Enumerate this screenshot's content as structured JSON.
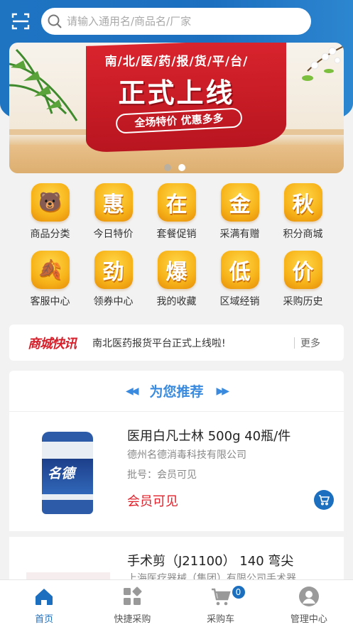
{
  "header": {
    "search_placeholder": "请输入通用名/商品名/厂家",
    "scan_icon": "scan-icon",
    "search_icon": "search-icon"
  },
  "banner": {
    "line1": "南/北/医/药/报/货/平/台/",
    "line2": "正式上线",
    "line3": "全场特价  优惠多多",
    "slide_count": 2,
    "active_slide": 2
  },
  "grid": [
    {
      "label": "商品分类",
      "glyph": "🐻"
    },
    {
      "label": "今日特价",
      "glyph": "惠"
    },
    {
      "label": "套餐促销",
      "glyph": "在"
    },
    {
      "label": "采满有赠",
      "glyph": "金"
    },
    {
      "label": "积分商城",
      "glyph": "秋"
    },
    {
      "label": "客服中心",
      "glyph": "🍂"
    },
    {
      "label": "领券中心",
      "glyph": "劲"
    },
    {
      "label": "我的收藏",
      "glyph": "爆"
    },
    {
      "label": "区域经销",
      "glyph": "低"
    },
    {
      "label": "采购历史",
      "glyph": "价"
    }
  ],
  "news": {
    "logo": "商城快讯",
    "text": "南北医药报货平台正式上线啦!",
    "more": "更多"
  },
  "recommend": {
    "title": "为您推荐",
    "left_arrows": "◀◀",
    "right_arrows": "▶▶",
    "products": [
      {
        "name": "医用白凡士林 500g 40瓶/件",
        "company": "德州名德消毒科技有限公司",
        "batch": "批号：会员可见",
        "price": "会员可见",
        "image_brand": "名德"
      },
      {
        "name": "手术剪（J21100） 140 弯尖",
        "company": "上海医疗器械（集团）有限公司手术器"
      }
    ]
  },
  "tabbar": {
    "tabs": [
      {
        "label": "首页",
        "icon": "home-icon",
        "active": true
      },
      {
        "label": "快捷采购",
        "icon": "grid-apps-icon",
        "active": false
      },
      {
        "label": "采购车",
        "icon": "cart-icon",
        "active": false
      },
      {
        "label": "管理中心",
        "icon": "user-icon",
        "active": false
      }
    ],
    "cart_count": "0"
  },
  "colors": {
    "brand_blue": "#1c6fbf",
    "accent_red": "#e0202a",
    "icon_gold": "#f7b319"
  }
}
